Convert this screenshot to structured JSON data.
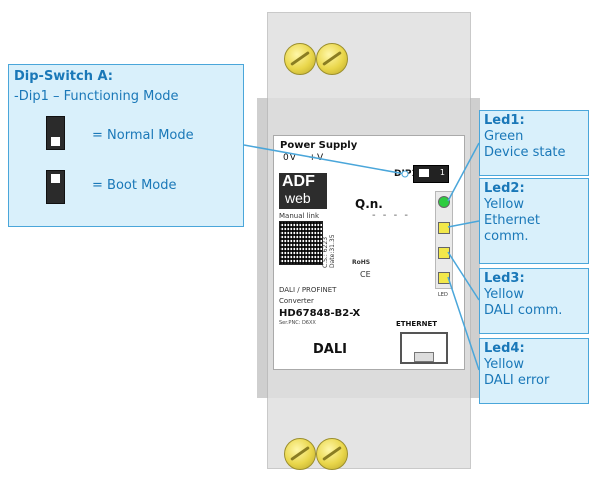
{
  "dip_callout": {
    "title": "Dip-Switch A:",
    "description": "-Dip1 – Functioning Mode",
    "normal_mode": "= Normal Mode",
    "boot_mode": "= Boot Mode"
  },
  "device": {
    "power_supply": "Power Supply",
    "power_terminals": "0V   +V",
    "logo_top": "ADF",
    "logo_bottom": "web",
    "manual_link": "Manual link",
    "specs_vertical": "C.S.: 6223 Date:31.35",
    "qn": "Q.n.",
    "qn_dashes": "- - - -",
    "rohs": "RoHS",
    "ce": "CE",
    "product_family": "DALI / PROFINET",
    "converter": "Converter",
    "model": "HD67848-B2-X",
    "serial": "Ser.PNC: D6XX",
    "dali": "DALI",
    "ethernet": "ETHERNET",
    "dip1": "DIP1",
    "dip1_number": "1",
    "led_caption": "LED"
  },
  "leds": [
    {
      "title": "Led1:",
      "color_name": "Green",
      "line1": "Device state",
      "line2": "",
      "color": "#2ecc40"
    },
    {
      "title": "Led2:",
      "color_name": "Yellow",
      "line1": "Ethernet",
      "line2": "comm.",
      "color": "#f2e84a"
    },
    {
      "title": "Led3:",
      "color_name": "Yellow",
      "line1": "DALI comm.",
      "line2": "",
      "color": "#f2e84a"
    },
    {
      "title": "Led4:",
      "color_name": "Yellow",
      "line1": "DALI error",
      "line2": "",
      "color": "#f2e84a"
    }
  ],
  "colors": {
    "callout_bg": "#d9f0fb",
    "callout_border": "#4aa6da",
    "callout_text": "#1a78b8"
  }
}
